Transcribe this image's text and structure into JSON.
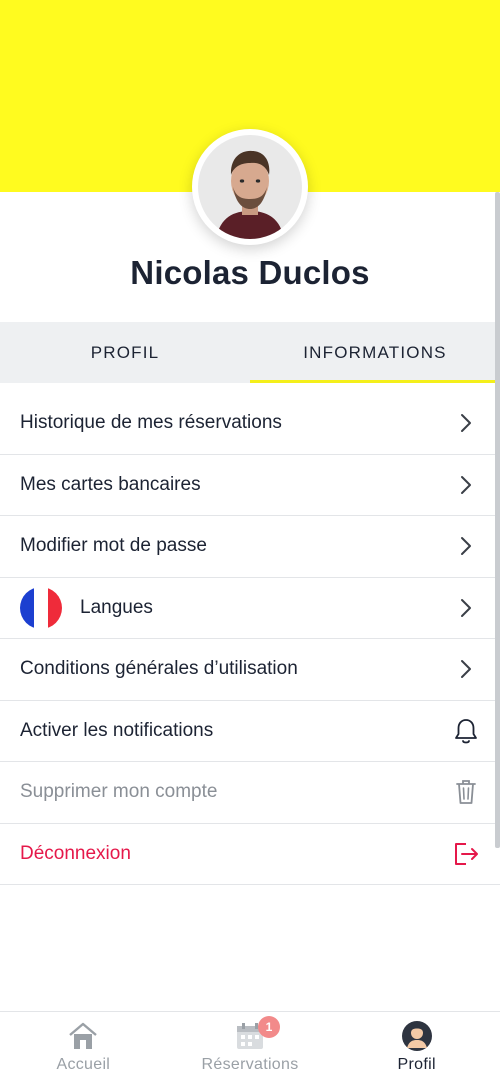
{
  "profile": {
    "name": "Nicolas Duclos"
  },
  "tabs": [
    {
      "label": "PROFIL",
      "active": false
    },
    {
      "label": "INFORMATIONS",
      "active": true
    }
  ],
  "menu": {
    "history": "Historique de mes réservations",
    "cards": "Mes cartes bancaires",
    "password": "Modifier mot de passe",
    "languages": "Langues",
    "terms": "Conditions générales d’utilisation",
    "notifications": "Activer les notifications",
    "delete_account": "Supprimer mon compte",
    "logout": "Déconnexion"
  },
  "icons": {
    "chevron": "chevron-right-icon",
    "flag": "france-flag-icon",
    "bell": "bell-icon",
    "trash": "trash-icon",
    "logout": "logout-icon"
  },
  "nav": {
    "home": "Accueil",
    "bookings": "Réservations",
    "bookings_badge": "1",
    "profile": "Profil"
  },
  "colors": {
    "header_yellow": "#fffb1f",
    "tab_indicator": "#f4ef1a",
    "danger": "#e5184a",
    "badge": "#f28a8a"
  }
}
